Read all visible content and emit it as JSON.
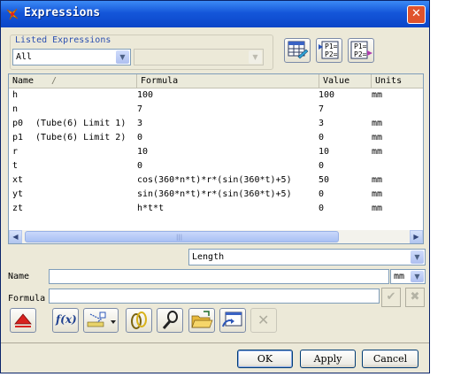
{
  "window": {
    "title": "Expressions",
    "close_glyph": "✕"
  },
  "listed_expressions": {
    "label": "Listed Expressions",
    "filter_value": "All",
    "secondary_value": ""
  },
  "toolbar_top": {
    "icons": [
      "spreadsheet-edit-icon",
      "export-parameters-icon",
      "import-parameters-icon"
    ],
    "p1": "P1=",
    "p2": "P2="
  },
  "table": {
    "columns": [
      "Name",
      "Formula",
      "Value",
      "Units"
    ],
    "sort_glyph": "/",
    "rows": [
      {
        "name": "h",
        "comment": "",
        "formula": "100",
        "value": "100",
        "units": "mm"
      },
      {
        "name": "n",
        "comment": "",
        "formula": "7",
        "value": "7",
        "units": ""
      },
      {
        "name": "p0",
        "comment": "(Tube(6) Limit 1)",
        "formula": "3",
        "value": "3",
        "units": "mm"
      },
      {
        "name": "p1",
        "comment": "(Tube(6) Limit 2)",
        "formula": "0",
        "value": "0",
        "units": "mm"
      },
      {
        "name": "r",
        "comment": "",
        "formula": "10",
        "value": "10",
        "units": "mm"
      },
      {
        "name": "t",
        "comment": "",
        "formula": "0",
        "value": "0",
        "units": ""
      },
      {
        "name": "xt",
        "comment": "",
        "formula": "cos(360*n*t)*r*(sin(360*t)+5)",
        "value": "50",
        "units": "mm"
      },
      {
        "name": "yt",
        "comment": "",
        "formula": "sin(360*n*t)*r*(sin(360*t)+5)",
        "value": "0",
        "units": "mm"
      },
      {
        "name": "zt",
        "comment": "",
        "formula": "h*t*t",
        "value": "0",
        "units": "mm"
      }
    ]
  },
  "type_select": {
    "value": "Length"
  },
  "name_field": {
    "label": "Name",
    "value": "",
    "units_value": "mm"
  },
  "formula_field": {
    "label": "Formula",
    "value": "",
    "accept_glyph": "✔",
    "reject_glyph": "✖"
  },
  "toolbar_bottom": {
    "fx_label": "f(x)",
    "disabled_glyph": "✕"
  },
  "buttons": {
    "ok": "OK",
    "apply": "Apply",
    "cancel": "Cancel"
  }
}
